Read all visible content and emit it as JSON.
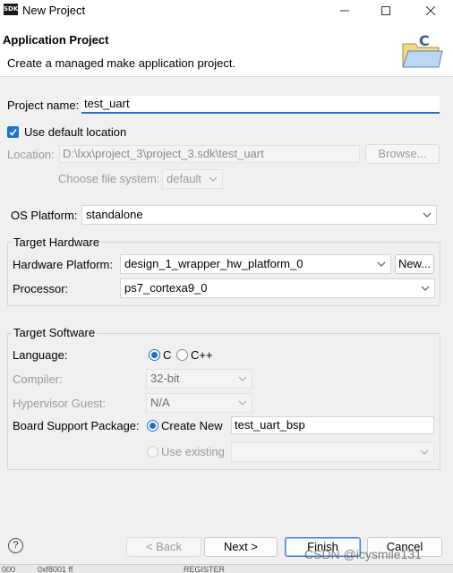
{
  "window": {
    "app_badge": "SDK",
    "title": "New Project"
  },
  "header": {
    "title": "Application Project",
    "description": "Create a managed make application project."
  },
  "project": {
    "name_label": "Project name:",
    "name_value": "test_uart",
    "use_default_label": "Use default location",
    "use_default_checked": true,
    "location_label": "Location:",
    "location_value": "D:\\lxx\\project_3\\project_3.sdk\\test_uart",
    "browse_label": "Browse...",
    "filesystem_label": "Choose file system:",
    "filesystem_value": "default"
  },
  "os": {
    "label": "OS Platform:",
    "value": "standalone"
  },
  "target_hardware": {
    "group_title": "Target Hardware",
    "hw_platform_label": "Hardware Platform:",
    "hw_platform_value": "design_1_wrapper_hw_platform_0",
    "new_button": "New...",
    "processor_label": "Processor:",
    "processor_value": "ps7_cortexa9_0"
  },
  "target_software": {
    "group_title": "Target Software",
    "language_label": "Language:",
    "lang_c": "C",
    "lang_cpp": "C++",
    "language_selected": "C",
    "compiler_label": "Compiler:",
    "compiler_value": "32-bit",
    "hypervisor_label": "Hypervisor Guest:",
    "hypervisor_value": "N/A",
    "bsp_label": "Board Support Package:",
    "create_new_label": "Create New",
    "bsp_name": "test_uart_bsp",
    "use_existing_label": "Use existing"
  },
  "footer": {
    "help": "?",
    "back": "< Back",
    "next": "Next >",
    "finish": "Finish",
    "cancel": "Cancel"
  },
  "background_strip": {
    "left": "000",
    "mid": "0xf8001 ff",
    "right": "REGISTER"
  },
  "watermark": "CSDN @icysmile131",
  "colors": {
    "accent": "#1f6fd1",
    "focus_underline": "#2d6fcf",
    "dialog_bg": "#f0f0f0"
  }
}
